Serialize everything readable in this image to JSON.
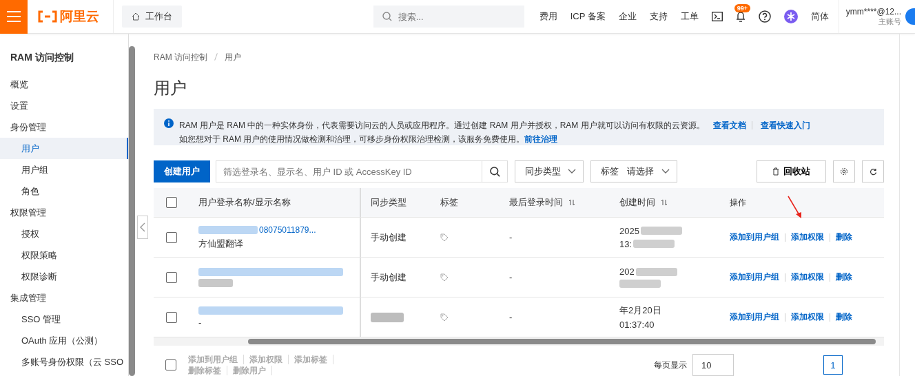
{
  "topbar": {
    "logo": "阿里云",
    "workbench": "工作台",
    "search": {
      "placeholder": "搜索..."
    },
    "links": [
      "费用",
      "ICP 备案",
      "企业",
      "支持",
      "工单"
    ],
    "notification_badge": "99+",
    "language": "简体",
    "account": {
      "name": "ymm****@12...",
      "role": "主账号"
    }
  },
  "sidebar": {
    "title": "RAM 访问控制",
    "items": [
      {
        "label": "概览",
        "selected": false
      },
      {
        "label": "设置",
        "selected": false
      },
      {
        "label": "身份管理",
        "selected": false,
        "children": [
          {
            "label": "用户",
            "selected": true
          },
          {
            "label": "用户组",
            "selected": false
          },
          {
            "label": "角色",
            "selected": false
          }
        ]
      },
      {
        "label": "权限管理",
        "selected": false,
        "children": [
          {
            "label": "授权",
            "selected": false
          },
          {
            "label": "权限策略",
            "selected": false
          },
          {
            "label": "权限诊断",
            "selected": false
          }
        ]
      },
      {
        "label": "集成管理",
        "selected": false,
        "children": [
          {
            "label": "SSO 管理",
            "selected": false
          },
          {
            "label": "OAuth 应用（公测）",
            "selected": false
          },
          {
            "label": "多账号身份权限（云 SSO",
            "selected": false
          }
        ]
      }
    ]
  },
  "breadcrumb": [
    "RAM 访问控制",
    "用户"
  ],
  "page_title": "用户",
  "notice": {
    "line1": "RAM 用户是 RAM 中的一种实体身份，代表需要访问云的人员或应用程序。通过创建 RAM 用户并授权，RAM 用户就可以访问有权限的云资源。",
    "links1": [
      "查看文档",
      "查看快速入门"
    ],
    "line2": "如您想对于 RAM 用户的使用情况做检测和治理，可移步身份权限治理检测，该服务免费使用。",
    "link2": "前往治理"
  },
  "toolbar": {
    "create": "创建用户",
    "search": {
      "placeholder": "筛选登录名、显示名、用户 ID 或 AccessKey ID"
    },
    "sync_filter": "同步类型",
    "tag_filter": {
      "label": "标签",
      "placeholder": "请选择"
    },
    "recycle": "回收站"
  },
  "table": {
    "select_all_checked": false,
    "columns": [
      "用户登录名称/显示名称",
      "同步类型",
      "标签",
      "最后登录时间",
      "创建时间",
      "操作"
    ],
    "rows": [
      {
        "checked": false,
        "login": "08075011879...",
        "display": "方仙盟翻译",
        "sync": "手动创建",
        "last_login": "-",
        "created": [
          "2025",
          "13:"
        ],
        "actions": [
          "添加到用户组",
          "添加权限",
          "删除"
        ]
      },
      {
        "checked": false,
        "sync": "手动创建",
        "last_login": "-",
        "created": [
          "202"
        ],
        "actions": [
          "添加到用户组",
          "添加权限",
          "删除"
        ]
      },
      {
        "checked": false,
        "display": "-",
        "last_login": "-",
        "created": [
          "年2月20日",
          "01:37:40"
        ],
        "actions": [
          "添加到用户组",
          "添加权限",
          "删除"
        ]
      }
    ]
  },
  "bulk_select_all_checked": false,
  "bulk_actions": [
    "添加到用户组",
    "添加权限",
    "添加标签",
    "删除标签",
    "删除用户"
  ],
  "pagination": {
    "label": "每页显示",
    "page_size": "10",
    "current_page": "1"
  }
}
